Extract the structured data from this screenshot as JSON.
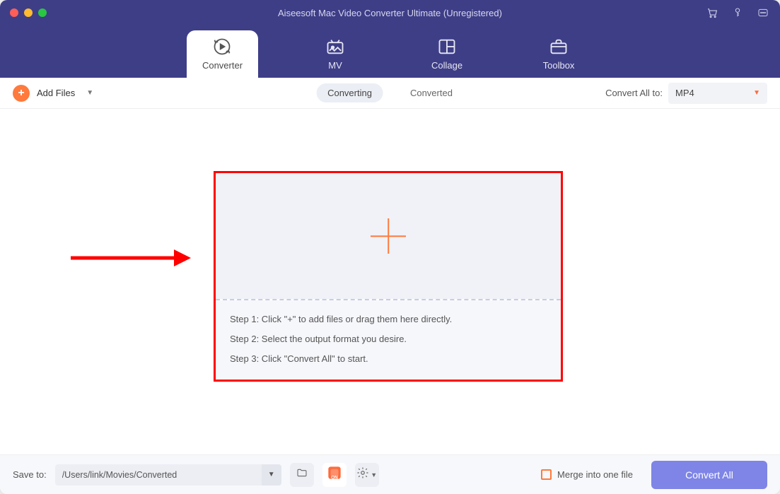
{
  "colors": {
    "accent": "#ff7a3c",
    "header": "#3e3e87",
    "primary_btn": "#7e85e6",
    "annotation": "#ff0000"
  },
  "window": {
    "title": "Aiseesoft Mac Video Converter Ultimate (Unregistered)"
  },
  "nav": {
    "tabs": [
      {
        "label": "Converter",
        "icon": "converter-icon",
        "active": true
      },
      {
        "label": "MV",
        "icon": "mv-icon",
        "active": false
      },
      {
        "label": "Collage",
        "icon": "collage-icon",
        "active": false
      },
      {
        "label": "Toolbox",
        "icon": "toolbox-icon",
        "active": false
      }
    ]
  },
  "toolbar": {
    "add_files_label": "Add Files",
    "seg": {
      "converting": "Converting",
      "converted": "Converted"
    },
    "convert_all_to_label": "Convert All to:",
    "selected_format": "MP4"
  },
  "dropzone": {
    "steps": [
      "Step 1: Click \"+\" to add files or drag them here directly.",
      "Step 2: Select the output format you desire.",
      "Step 3: Click \"Convert All\" to start."
    ]
  },
  "footer": {
    "save_to_label": "Save to:",
    "path": "/Users/link/Movies/Converted",
    "merge_label": "Merge into one file",
    "convert_all_label": "Convert All"
  }
}
